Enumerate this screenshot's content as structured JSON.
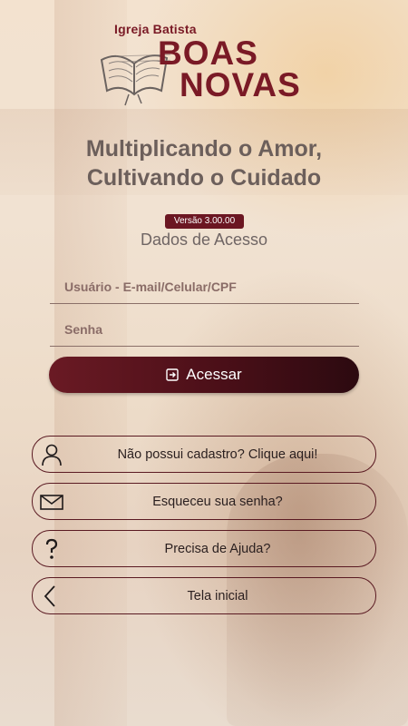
{
  "logo": {
    "church_prefix": "Igreja Batista",
    "name_line1": "BOAS",
    "name_line2": "NOVAS"
  },
  "headline": {
    "line1": "Multiplicando o Amor,",
    "line2": "Cultivando o Cuidado"
  },
  "version": "Versão 3.00.00",
  "section_title": "Dados de Acesso",
  "form": {
    "user_placeholder": "Usuário - E-mail/Celular/CPF",
    "user_value": "",
    "password_placeholder": "Senha",
    "password_value": "",
    "login_label": "Acessar"
  },
  "links": [
    {
      "label": "Não possui cadastro? Clique aqui!",
      "icon": "user-icon"
    },
    {
      "label": "Esqueceu sua senha?",
      "icon": "mail-icon"
    },
    {
      "label": "Precisa de Ajuda?",
      "icon": "help-icon"
    },
    {
      "label": "Tela inicial",
      "icon": "back-icon"
    }
  ],
  "colors": {
    "brand": "#7a1a26",
    "button_dark": "#2c0a10",
    "badge": "#6b1622"
  }
}
